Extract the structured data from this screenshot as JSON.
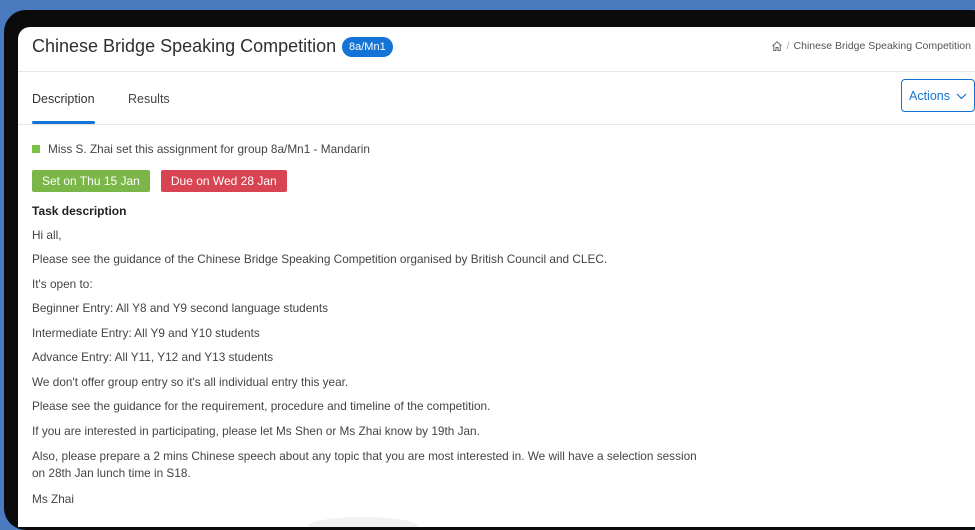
{
  "header": {
    "title": "Chinese Bridge Speaking Competition",
    "group_badge": "8a/Mn1",
    "breadcrumb_separator": "/",
    "breadcrumb_current": "Chinese Bridge Speaking Competition"
  },
  "tabs": [
    {
      "label": "Description",
      "active": true
    },
    {
      "label": "Results",
      "active": false
    }
  ],
  "actions_label": "Actions",
  "assignment": {
    "set_by_text": "Miss S. Zhai set this assignment for group 8a/Mn1 - Mandarin",
    "set_on": "Set on Thu 15 Jan",
    "due_on": "Due on Wed 28 Jan"
  },
  "task": {
    "heading": "Task description",
    "paragraphs": [
      "Hi all,",
      "Please see the guidance of the Chinese Bridge Speaking Competition organised by British Council and CLEC.",
      "It's open to:",
      "Beginner Entry: All Y8 and Y9 second language students",
      "Intermediate Entry: All Y9 and Y10 students",
      "Advance Entry: All Y11, Y12 and Y13 students",
      "We don't offer group entry so it's all individual entry this year.",
      "Please see the guidance for the requirement, procedure and timeline of the competition.",
      "If you are interested in participating, please let Ms Shen or Ms Zhai know by 19th Jan.",
      "Also, please prepare a 2 mins Chinese speech about any topic that you are most interested in. We will have a selection session on 28th Jan lunch time in S18.",
      "Ms Zhai"
    ]
  },
  "colors": {
    "accent": "#1473d6",
    "set_badge": "#7ab648",
    "due_badge": "#d94452",
    "group_marker": "#7bbf44"
  },
  "icons": {
    "home": "home-icon",
    "actions_dropdown": "chevron-down-icon",
    "group_marker": "square-icon"
  }
}
